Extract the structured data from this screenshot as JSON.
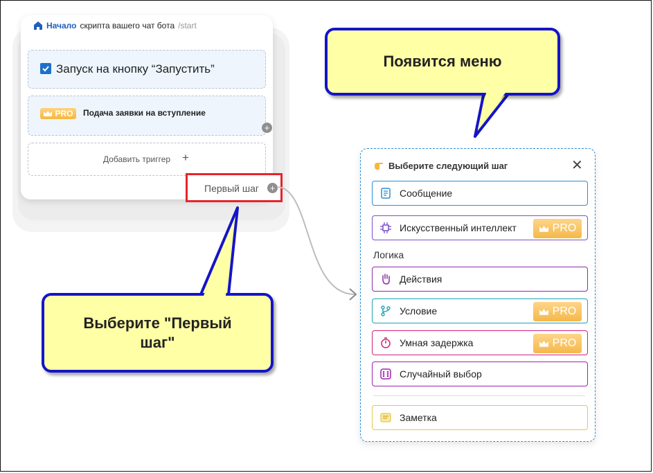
{
  "start_node": {
    "title_bold": "Начало",
    "title_rest": "скрипта вашего чат бота",
    "route": "/start",
    "triggers": [
      {
        "label": "Запуск на кнопку “Запустить”"
      },
      {
        "badge": "PRO",
        "label": "Подача заявки на вступление"
      }
    ],
    "add_trigger_label": "Добавить триггер",
    "first_step_label": "Первый шаг"
  },
  "callouts": {
    "menu_appears": "Появится меню",
    "choose_first_step": "Выберите \"Первый шаг\""
  },
  "menu": {
    "title": "Выберите следующий шаг",
    "items": [
      {
        "label": "Сообщение",
        "icon": "message-icon",
        "color": "#2a8ed3"
      },
      {
        "label": "Искусственный интеллект",
        "icon": "ai-chip-icon",
        "color": "#7b4fc9",
        "badge": "PRO"
      }
    ],
    "logic_label": "Логика",
    "logic_items": [
      {
        "label": "Действия",
        "icon": "hand-icon",
        "color": "#8b2aa8"
      },
      {
        "label": "Условие",
        "icon": "branch-icon",
        "color": "#1aa3b5",
        "badge": "PRO"
      },
      {
        "label": "Умная задержка",
        "icon": "timer-icon",
        "color": "#d0207a",
        "badge": "PRO"
      },
      {
        "label": "Случайный выбор",
        "icon": "dice-icon",
        "color": "#a020b0"
      }
    ],
    "note": {
      "label": "Заметка",
      "icon": "note-icon",
      "color": "#e6c84a"
    }
  }
}
